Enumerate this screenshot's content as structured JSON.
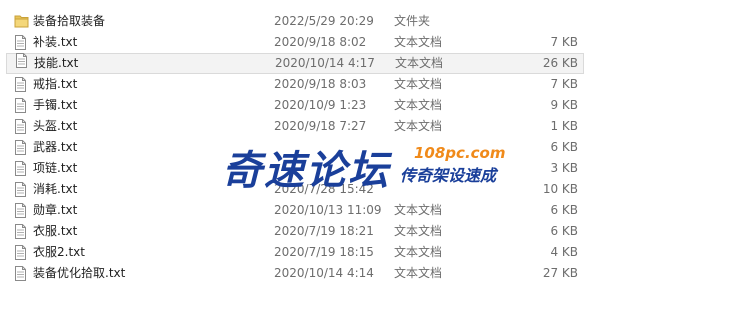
{
  "files": [
    {
      "icon": "folder-icon",
      "name": "装备拾取装备",
      "modified": "2022/5/29 20:29",
      "type": "文件夹",
      "size": ""
    },
    {
      "icon": "text-file-icon",
      "name": "补装.txt",
      "modified": "2020/9/18 8:02",
      "type": "文本文档",
      "size": "7 KB"
    },
    {
      "icon": "text-file-icon",
      "name": "技能.txt",
      "modified": "2020/10/14 4:17",
      "type": "文本文档",
      "size": "26 KB",
      "selected": true
    },
    {
      "icon": "text-file-icon",
      "name": "戒指.txt",
      "modified": "2020/9/18 8:03",
      "type": "文本文档",
      "size": "7 KB"
    },
    {
      "icon": "text-file-icon",
      "name": "手镯.txt",
      "modified": "2020/10/9 1:23",
      "type": "文本文档",
      "size": "9 KB"
    },
    {
      "icon": "text-file-icon",
      "name": "头盔.txt",
      "modified": "2020/9/18 7:27",
      "type": "文本文档",
      "size": "1 KB"
    },
    {
      "icon": "text-file-icon",
      "name": "武器.txt",
      "modified": "",
      "type": "",
      "size": "6 KB"
    },
    {
      "icon": "text-file-icon",
      "name": "项链.txt",
      "modified": "",
      "type": "",
      "size": "3 KB"
    },
    {
      "icon": "text-file-icon",
      "name": "消耗.txt",
      "modified": "2020/7/28 15:42",
      "type": "",
      "size": "10 KB"
    },
    {
      "icon": "text-file-icon",
      "name": "勋章.txt",
      "modified": "2020/10/13 11:09",
      "type": "文本文档",
      "size": "6 KB"
    },
    {
      "icon": "text-file-icon",
      "name": "衣服.txt",
      "modified": "2020/7/19 18:21",
      "type": "文本文档",
      "size": "6 KB"
    },
    {
      "icon": "text-file-icon",
      "name": "衣服2.txt",
      "modified": "2020/7/19 18:15",
      "type": "文本文档",
      "size": "4 KB"
    },
    {
      "icon": "text-file-icon",
      "name": "装备优化拾取.txt",
      "modified": "2020/10/14 4:14",
      "type": "文本文档",
      "size": "27 KB"
    }
  ],
  "watermark": {
    "main": "奇速论坛",
    "domain": "108pc.com",
    "sub": "传奇架设速成"
  }
}
